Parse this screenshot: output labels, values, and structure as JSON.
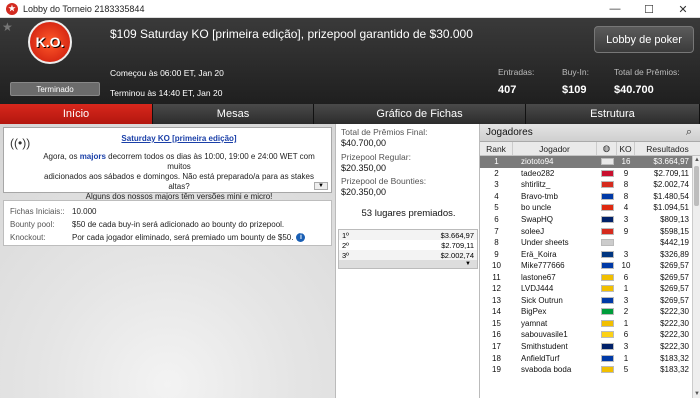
{
  "window": {
    "title": "Lobby do Torneio 2183335844",
    "minimize": "—",
    "maximize": "☐",
    "close": "✕"
  },
  "header": {
    "logo_text": "K.O.",
    "tournament_name": "$109 Saturday KO [primeira edição], prizepool garantido de $30.000",
    "lobby_button": "Lobby de poker",
    "status": "Terminado",
    "started": "Começou às 06:00 ET, Jan 20",
    "ended": "Terminou às 14:40 ET, Jan 20",
    "entries_label": "Entradas:",
    "entries_value": "407",
    "buyin_label": "Buy-In:",
    "buyin_value": "$109",
    "prize_label": "Total de Prêmios:",
    "prize_value": "$40.700"
  },
  "tabs": [
    {
      "label": "Início",
      "active": true
    },
    {
      "label": "Mesas",
      "active": false
    },
    {
      "label": "Gráfico de Fichas",
      "active": false
    },
    {
      "label": "Estrutura",
      "active": false
    }
  ],
  "announcement": {
    "title": "Saturday KO [primeira edição]",
    "line1_pre": "Agora, os ",
    "line1_hl": "majors",
    "line1_post": " decorrem todos os dias às 10:00, 19:00 e 24:00 WET com muitos",
    "line2": "adicionados aos sábados e domingos. Não está preparado/a para as stakes altas?",
    "line3": "Alguns dos nossos majors têm versões mini e micro!"
  },
  "info": {
    "chips_label": "Fichas Iniciais::",
    "chips_value": "10.000",
    "bounty_label": "Bounty pool:",
    "bounty_value": "$50 de cada buy-in será adicionado ao bounty do prizepool.",
    "knockout_label": "Knockout:",
    "knockout_value": "Por cada jogador eliminado, será premiado um bounty de $50."
  },
  "prizes": {
    "total_label": "Total de Prêmios Final:",
    "total_value": "$40.700,00",
    "regular_label": "Prizepool Regular:",
    "regular_value": "$20.350,00",
    "bounties_label": "Prizepool de Bounties:",
    "bounties_value": "$20.350,00",
    "places": "53 lugares premiados.",
    "table": [
      {
        "place": "1º",
        "amount": "$3.664,97"
      },
      {
        "place": "2º",
        "amount": "$2.709,11"
      },
      {
        "place": "3º",
        "amount": "$2.002,74"
      }
    ]
  },
  "players": {
    "title": "Jogadores",
    "col_rank": "Rank",
    "col_player": "Jogador",
    "col_ko": "KO",
    "col_results": "Resultados",
    "rows": [
      {
        "rank": "1",
        "name": "ziototo94",
        "flag": "#e8e8e8",
        "ko": "16",
        "result": "$3.664,97"
      },
      {
        "rank": "2",
        "name": "tadeo282",
        "flag": "#c8102e",
        "ko": "9",
        "result": "$2.709,11"
      },
      {
        "rank": "3",
        "name": "shtirlitz_",
        "flag": "#d52b1e",
        "ko": "8",
        "result": "$2.002,74"
      },
      {
        "rank": "4",
        "name": "Bravo-tmb",
        "flag": "#0039a6",
        "ko": "8",
        "result": "$1.480,54"
      },
      {
        "rank": "5",
        "name": "bo uncle",
        "flag": "#de2910",
        "ko": "4",
        "result": "$1.094,51"
      },
      {
        "rank": "6",
        "name": "SwapHQ",
        "flag": "#012169",
        "ko": "3",
        "result": "$809,13"
      },
      {
        "rank": "7",
        "name": "soleeJ",
        "flag": "#d52b1e",
        "ko": "9",
        "result": "$598,15"
      },
      {
        "rank": "8",
        "name": "Under sheets",
        "flag": "#cccccc",
        "ko": "",
        "result": "$442,19"
      },
      {
        "rank": "9",
        "name": "Erä_Koira",
        "flag": "#003580",
        "ko": "3",
        "result": "$326,89"
      },
      {
        "rank": "10",
        "name": "Mike777666",
        "flag": "#0039a6",
        "ko": "10",
        "result": "$269,57"
      },
      {
        "rank": "11",
        "name": "lastone67",
        "flag": "#f1bf00",
        "ko": "6",
        "result": "$269,57"
      },
      {
        "rank": "12",
        "name": "LVDJ444",
        "flag": "#f1bf00",
        "ko": "1",
        "result": "$269,57"
      },
      {
        "rank": "13",
        "name": "Sick Outrun",
        "flag": "#0039a6",
        "ko": "3",
        "result": "$269,57"
      },
      {
        "rank": "14",
        "name": "BigPex",
        "flag": "#009c3b",
        "ko": "2",
        "result": "$222,30"
      },
      {
        "rank": "15",
        "name": "yamnat",
        "flag": "#f1bf00",
        "ko": "1",
        "result": "$222,30"
      },
      {
        "rank": "16",
        "name": "sabouvasile1",
        "flag": "#fcd116",
        "ko": "6",
        "result": "$222,30"
      },
      {
        "rank": "17",
        "name": "Smithstudent",
        "flag": "#012169",
        "ko": "3",
        "result": "$222,30"
      },
      {
        "rank": "18",
        "name": "AnfieldTurf",
        "flag": "#0039a6",
        "ko": "1",
        "result": "$183,32"
      },
      {
        "rank": "19",
        "name": "svaboda boda",
        "flag": "#f1bf00",
        "ko": "5",
        "result": "$183,32"
      }
    ]
  }
}
